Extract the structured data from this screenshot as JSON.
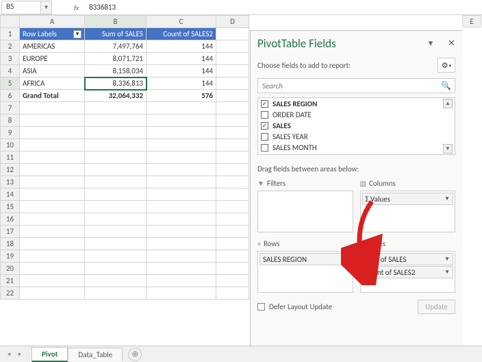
{
  "namebox": {
    "cell": "B5",
    "formula": "8336813"
  },
  "columns": [
    "A",
    "B",
    "C",
    "D"
  ],
  "extra_col": "E",
  "pt": {
    "headers": {
      "rowlabels": "Row Labels",
      "sum": "Sum of SALES",
      "count": "Count of SALES2"
    },
    "rows": [
      {
        "label": "AMERICAS",
        "sum": "7,497,764",
        "count": "144"
      },
      {
        "label": "EUROPE",
        "sum": "8,071,721",
        "count": "144"
      },
      {
        "label": "ASIA",
        "sum": "8,158,034",
        "count": "144"
      },
      {
        "label": "AFRICA",
        "sum": "8,336,813",
        "count": "144"
      }
    ],
    "total": {
      "label": "Grand Total",
      "sum": "32,064,332",
      "count": "576"
    }
  },
  "empty_rows": [
    "7",
    "8",
    "9",
    "10",
    "11",
    "12",
    "13",
    "14",
    "15",
    "16",
    "17",
    "18",
    "19",
    "20",
    "21",
    "22"
  ],
  "pane": {
    "title": "PivotTable Fields",
    "choose_text": "Choose fields to add to report:",
    "search_placeholder": "Search",
    "fields": [
      {
        "name": "SALES REGION",
        "checked": true,
        "bold": true
      },
      {
        "name": "ORDER DATE",
        "checked": false,
        "bold": false
      },
      {
        "name": "SALES",
        "checked": true,
        "bold": true
      },
      {
        "name": "SALES YEAR",
        "checked": false,
        "bold": false
      },
      {
        "name": "SALES MONTH",
        "checked": false,
        "bold": false
      }
    ],
    "drag_text": "Drag fields between areas below:",
    "areas": {
      "filters": {
        "title": "Filters",
        "items": []
      },
      "columns": {
        "title": "Columns",
        "items": [
          "Values"
        ],
        "sigma": true
      },
      "rows": {
        "title": "Rows",
        "items": [
          "SALES REGION"
        ]
      },
      "values": {
        "title": "Values",
        "items": [
          "Sum of SALES",
          "Count of SALES2"
        ]
      }
    },
    "defer_label": "Defer Layout Update",
    "update_label": "Update"
  },
  "tabs": {
    "active": "Pivot",
    "other": "Data_Table"
  }
}
